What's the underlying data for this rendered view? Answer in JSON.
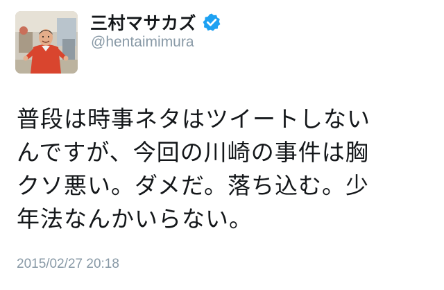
{
  "user": {
    "display_name": "三村マサカズ",
    "handle": "@hentaimimura",
    "verified": true,
    "avatar_icon": "profile-photo",
    "verified_icon": "verified-badge-icon",
    "verified_color": "#1da1f2"
  },
  "tweet": {
    "text_lines": [
      "普段は時事ネタはツイートしない",
      "んですが、今回の川崎の事件は胸",
      "クソ悪い。ダメだ。落ち込む。少",
      "年法なんかいらない。"
    ],
    "timestamp": "2015/02/27 20:18"
  },
  "colors": {
    "text": "#14171a",
    "secondary": "#8899a6",
    "background": "#ffffff"
  }
}
